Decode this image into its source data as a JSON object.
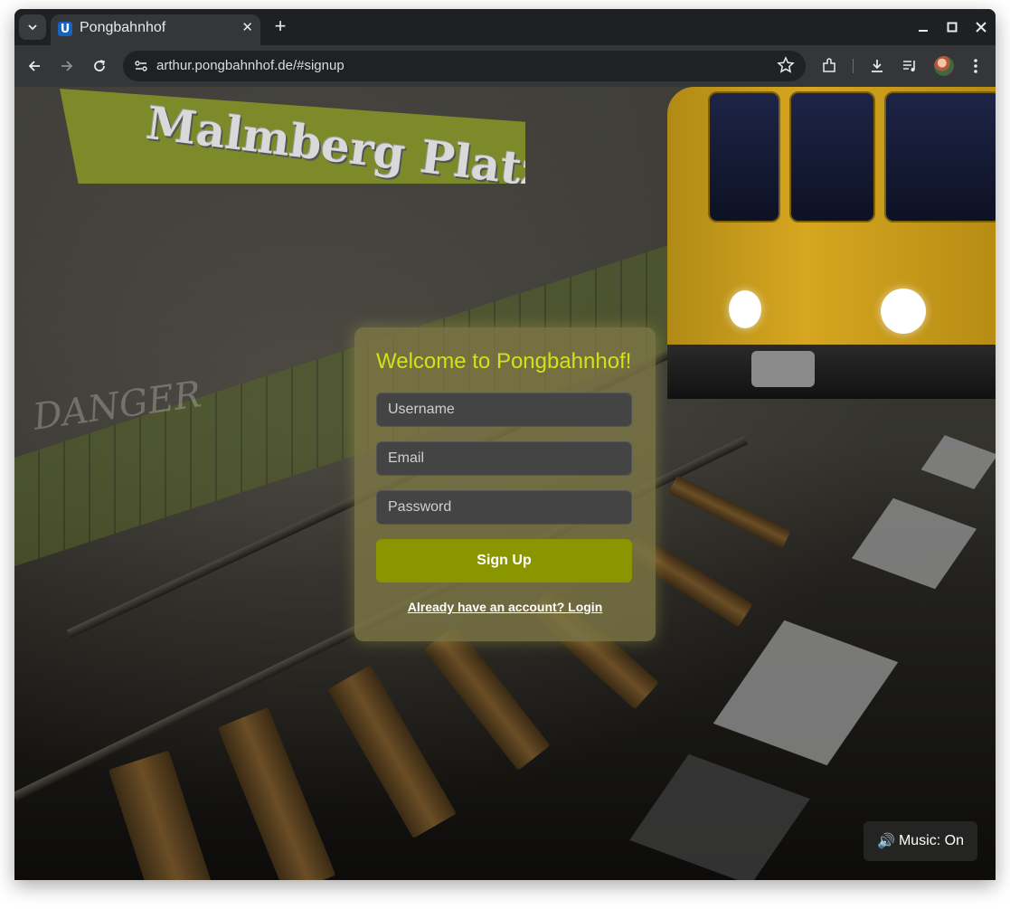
{
  "browser": {
    "tab": {
      "title": "Pongbahnhof",
      "favicon_letter": "U"
    },
    "url": "arthur.pongbahnhof.de/#signup"
  },
  "scene": {
    "sign_text": "Malmberg Platz",
    "graffiti_text": "DANGER"
  },
  "signup": {
    "title": "Welcome to Pongbahnhof!",
    "username_placeholder": "Username",
    "email_placeholder": "Email",
    "password_placeholder": "Password",
    "submit_label": "Sign Up",
    "login_link": "Already have an account? Login"
  },
  "music": {
    "icon": "speaker-icon",
    "label": "Music: On"
  },
  "colors": {
    "title": "#d4e01a",
    "submit": "#8a9600",
    "card": "#7c7646"
  }
}
